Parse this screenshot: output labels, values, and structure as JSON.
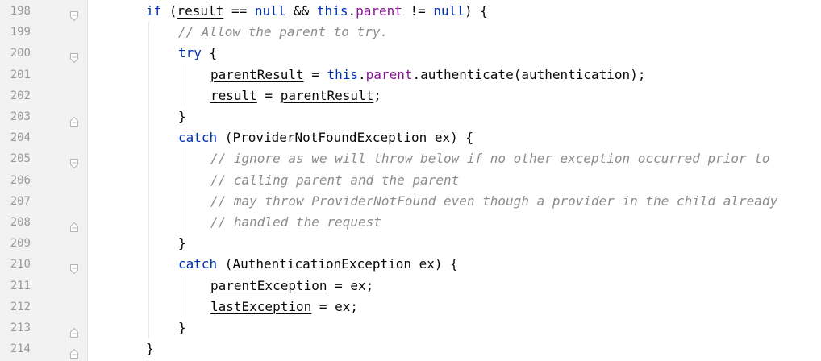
{
  "editor": {
    "lines": [
      {
        "n": "198",
        "fold": "open",
        "indent": 0,
        "tokens": [
          {
            "t": "if",
            "c": "kw"
          },
          {
            "t": " ("
          },
          {
            "t": "result",
            "c": "var"
          },
          {
            "t": " == "
          },
          {
            "t": "null",
            "c": "kw"
          },
          {
            "t": " && "
          },
          {
            "t": "this",
            "c": "kw"
          },
          {
            "t": "."
          },
          {
            "t": "parent",
            "c": "fld"
          },
          {
            "t": " != "
          },
          {
            "t": "null",
            "c": "kw"
          },
          {
            "t": ") {"
          }
        ]
      },
      {
        "n": "199",
        "fold": "",
        "indent": 1,
        "tokens": [
          {
            "t": "// Allow the parent to try.",
            "c": "cmt"
          }
        ]
      },
      {
        "n": "200",
        "fold": "open",
        "indent": 1,
        "tokens": [
          {
            "t": "try",
            "c": "kw"
          },
          {
            "t": " {"
          }
        ]
      },
      {
        "n": "201",
        "fold": "",
        "indent": 2,
        "tokens": [
          {
            "t": "parentResult",
            "c": "var"
          },
          {
            "t": " = "
          },
          {
            "t": "this",
            "c": "kw"
          },
          {
            "t": "."
          },
          {
            "t": "parent",
            "c": "fld"
          },
          {
            "t": ".authenticate(authentication);"
          }
        ]
      },
      {
        "n": "202",
        "fold": "",
        "indent": 2,
        "tokens": [
          {
            "t": "result",
            "c": "var"
          },
          {
            "t": " = "
          },
          {
            "t": "parentResult",
            "c": "var"
          },
          {
            "t": ";"
          }
        ]
      },
      {
        "n": "203",
        "fold": "close",
        "indent": 1,
        "tokens": [
          {
            "t": "}"
          }
        ]
      },
      {
        "n": "204",
        "fold": "",
        "indent": 1,
        "tokens": [
          {
            "t": "catch",
            "c": "kw"
          },
          {
            "t": " (ProviderNotFoundException ex) {"
          }
        ]
      },
      {
        "n": "205",
        "fold": "open",
        "indent": 2,
        "tokens": [
          {
            "t": "// ignore as we will throw below if no other exception occurred prior to",
            "c": "cmt"
          }
        ]
      },
      {
        "n": "206",
        "fold": "",
        "indent": 2,
        "tokens": [
          {
            "t": "// calling parent and the parent",
            "c": "cmt"
          }
        ]
      },
      {
        "n": "207",
        "fold": "",
        "indent": 2,
        "tokens": [
          {
            "t": "// may throw ProviderNotFound even though a provider in the child already",
            "c": "cmt"
          }
        ]
      },
      {
        "n": "208",
        "fold": "close",
        "indent": 2,
        "tokens": [
          {
            "t": "// handled the request",
            "c": "cmt"
          }
        ]
      },
      {
        "n": "209",
        "fold": "",
        "indent": 1,
        "tokens": [
          {
            "t": "}"
          }
        ]
      },
      {
        "n": "210",
        "fold": "open",
        "indent": 1,
        "tokens": [
          {
            "t": "catch",
            "c": "kw"
          },
          {
            "t": " (AuthenticationException ex) {"
          }
        ]
      },
      {
        "n": "211",
        "fold": "",
        "indent": 2,
        "tokens": [
          {
            "t": "parentException",
            "c": "var"
          },
          {
            "t": " = ex;"
          }
        ]
      },
      {
        "n": "212",
        "fold": "",
        "indent": 2,
        "tokens": [
          {
            "t": "lastException",
            "c": "var"
          },
          {
            "t": " = ex;"
          }
        ]
      },
      {
        "n": "213",
        "fold": "close",
        "indent": 1,
        "tokens": [
          {
            "t": "}"
          }
        ]
      },
      {
        "n": "214",
        "fold": "close",
        "indent": 0,
        "tokens": [
          {
            "t": "}"
          }
        ]
      }
    ]
  },
  "colors": {
    "keyword": "#0033b3",
    "field": "#871094",
    "comment": "#8c8c8c",
    "text": "#080808",
    "line_number": "#999999",
    "gutter_bg": "#f2f2f2"
  }
}
